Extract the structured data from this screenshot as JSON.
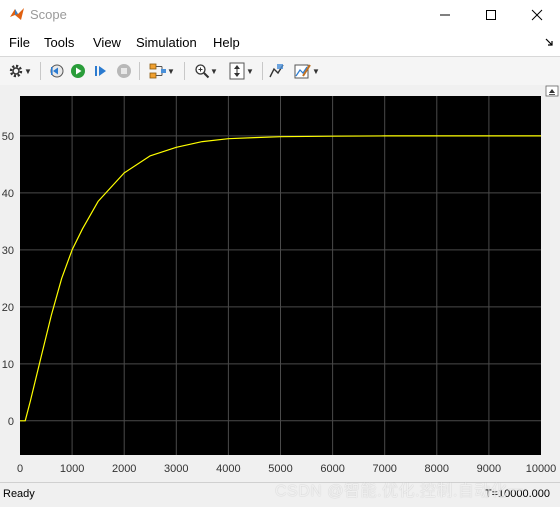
{
  "window": {
    "title": "Scope",
    "icon": "matlab-scope-icon"
  },
  "menu": {
    "items": [
      "File",
      "Tools",
      "View",
      "Simulation",
      "Help"
    ]
  },
  "toolbar": {
    "icons": [
      "gear-icon",
      "step-back-icon",
      "run-icon",
      "step-forward-icon",
      "stop-icon",
      "layout-icon",
      "zoom-icon",
      "autoscale-icon",
      "cursor-measure-icon",
      "edit-style-icon"
    ]
  },
  "chart_data": {
    "type": "line",
    "xlim": [
      0,
      10000
    ],
    "ylim": [
      -6,
      57
    ],
    "x_ticks": [
      "0",
      "1000",
      "2000",
      "3000",
      "4000",
      "5000",
      "6000",
      "7000",
      "8000",
      "9000",
      "10000"
    ],
    "y_ticks": [
      "0",
      "10",
      "20",
      "30",
      "40",
      "50"
    ],
    "grid": true,
    "background": "#000000",
    "line_color": "#ffff00",
    "series": [
      {
        "x": [
          0,
          100,
          200,
          400,
          600,
          800,
          1000,
          1200,
          1500,
          2000,
          2500,
          3000,
          3500,
          4000,
          4500,
          5000,
          6000,
          7000,
          8000,
          9000,
          10000
        ],
        "y": [
          0,
          0,
          3.5,
          11,
          18.5,
          25,
          30,
          33.7,
          38.5,
          43.5,
          46.5,
          48,
          49,
          49.5,
          49.7,
          49.85,
          49.95,
          50,
          50,
          50,
          50
        ]
      }
    ]
  },
  "status": {
    "left": "Ready",
    "right": "T=10000.000"
  },
  "watermark": "CSDN @智能.优化.控制.自动化一"
}
